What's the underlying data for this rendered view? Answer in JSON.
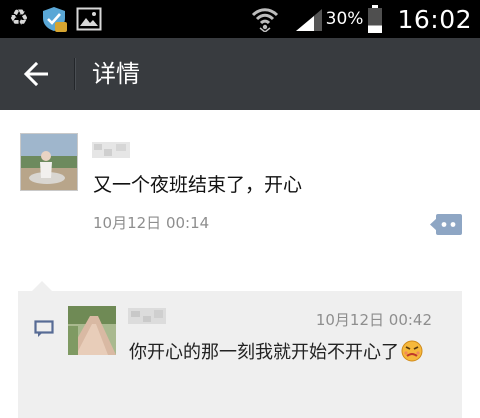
{
  "status_bar": {
    "battery_percent": "30%",
    "time": "16:02",
    "battery_level": 0.3
  },
  "header": {
    "title": "详情"
  },
  "post": {
    "text": "又一个夜班结束了，开心",
    "time": "10月12日 00:14"
  },
  "comment": {
    "time": "10月12日 00:42",
    "text": "你开心的那一刻我就开始不开心了"
  },
  "colors": {
    "status_bar_bg": "#000000",
    "title_bar_bg": "#383b3f",
    "comment_bg": "#efefef",
    "accent_blue": "#576b95"
  }
}
